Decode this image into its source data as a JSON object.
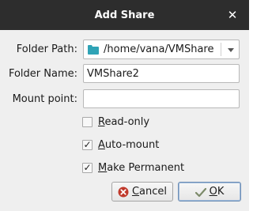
{
  "window": {
    "title": "Add Share"
  },
  "form": {
    "folder_path_label": "Folder Path:",
    "folder_path_value": "/home/vana/VMShare",
    "folder_name_label": "Folder Name:",
    "folder_name_value": "VMShare2",
    "mount_point_label": "Mount point:",
    "mount_point_value": ""
  },
  "options": [
    {
      "mnemonic": "R",
      "rest": "ead-only",
      "checked": false
    },
    {
      "mnemonic": "A",
      "rest": "uto-mount",
      "checked": true
    },
    {
      "mnemonic": "M",
      "rest": "ake Permanent",
      "checked": true
    }
  ],
  "buttons": {
    "cancel_mnemonic": "C",
    "cancel_rest": "ancel",
    "ok_mnemonic": "O",
    "ok_rest": "K"
  },
  "colors": {
    "titlebar": "#2d2d2d",
    "folder_icon": "#2fa3b6",
    "cancel_icon": "#c0392b"
  },
  "icons": [
    "close-icon",
    "folder-icon",
    "dropdown-arrow-icon",
    "checkmark-icon",
    "cancel-icon",
    "ok-icon"
  ]
}
